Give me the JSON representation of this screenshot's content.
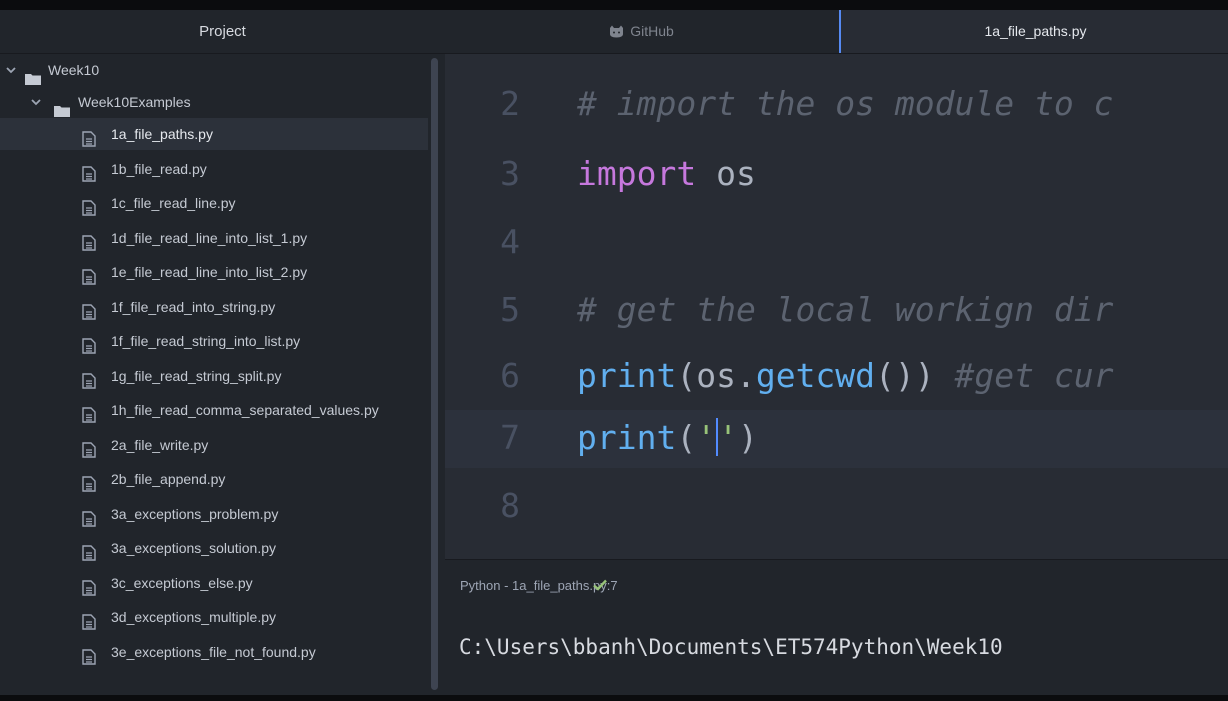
{
  "sidebar": {
    "title": "Project",
    "root_folder": "Week10",
    "sub_folder": "Week10Examples",
    "files": [
      "1a_file_paths.py",
      "1b_file_read.py",
      "1c_file_read_line.py",
      "1d_file_read_line_into_list_1.py",
      "1e_file_read_line_into_list_2.py",
      "1f_file_read_into_string.py",
      "1f_file_read_string_into_list.py",
      "1g_file_read_string_split.py",
      "1h_file_read_comma_separated_values.py",
      "2a_file_write.py",
      "2b_file_append.py",
      "3a_exceptions_problem.py",
      "3a_exceptions_solution.py",
      "3c_exceptions_else.py",
      "3d_exceptions_multiple.py",
      "3e_exceptions_file_not_found.py"
    ],
    "selected_file": "1a_file_paths.py"
  },
  "tabs": {
    "github": "GitHub",
    "active": "1a_file_paths.py"
  },
  "editor": {
    "line_numbers": [
      "2",
      "3",
      "4",
      "5",
      "6",
      "7",
      "8"
    ],
    "line2_comment": "# import the os module to c",
    "line3_keyword": "import",
    "line3_rest": " os",
    "line5_comment": "# get the local workign dir",
    "line6_fn": "print",
    "line6_p1": "(os.",
    "line6_method": "getcwd",
    "line6_p2": "()) ",
    "line6_comment": "#get cur",
    "line7_fn": "print",
    "line7_open": "(",
    "line7_q1": "'",
    "line7_q2": "'",
    "line7_close": ")"
  },
  "status": {
    "text": "Python - 1a_file_paths.py:7"
  },
  "output": {
    "text": "C:\\Users\\bbanh\\Documents\\ET574Python\\Week10"
  },
  "colors": {
    "accent": "#568af2",
    "keyword": "#c678dd",
    "function": "#61afef",
    "comment": "#5c6370",
    "string": "#98c379",
    "check": "#98c379"
  }
}
